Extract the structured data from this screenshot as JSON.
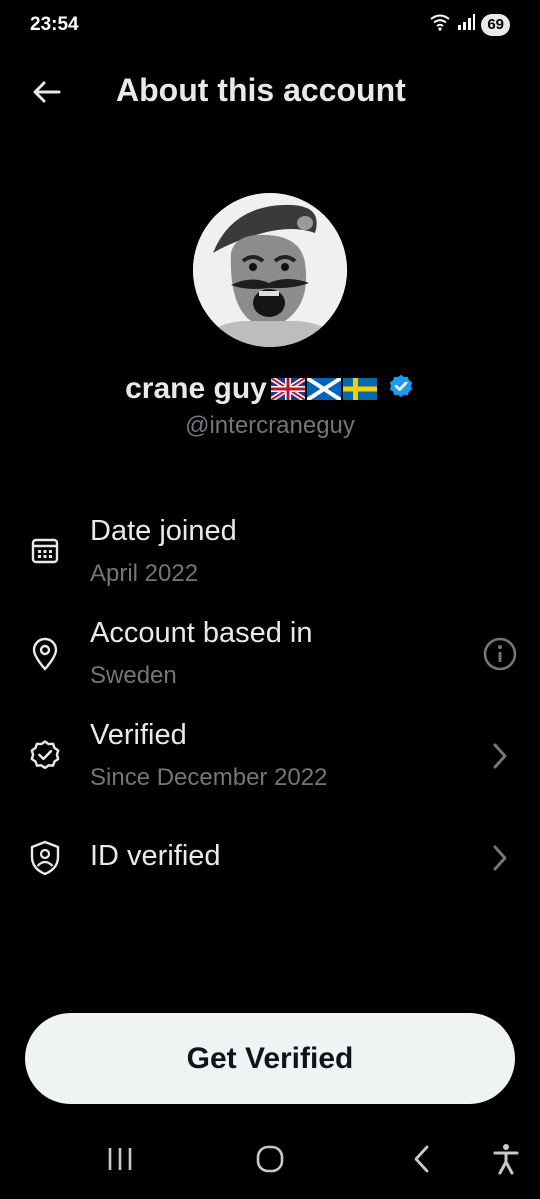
{
  "status_bar": {
    "time": "23:54",
    "battery": "69"
  },
  "header": {
    "title": "About this account"
  },
  "profile": {
    "display_name": "crane guy",
    "flags": [
      "uk-flag",
      "scotland-flag",
      "sweden-flag"
    ],
    "handle": "@intercraneguy",
    "verified_color": "#1d9bf0"
  },
  "rows": [
    {
      "icon": "calendar-icon",
      "title": "Date joined",
      "subtitle": "April 2022",
      "trailing": "none"
    },
    {
      "icon": "location-pin-icon",
      "title": "Account based in",
      "subtitle": "Sweden",
      "trailing": "info-icon"
    },
    {
      "icon": "verified-seal-icon",
      "title": "Verified",
      "subtitle": "Since December 2022",
      "trailing": "chevron-right-icon"
    },
    {
      "icon": "shield-user-icon",
      "title": "ID verified",
      "subtitle": "",
      "trailing": "chevron-right-icon"
    }
  ],
  "cta": {
    "label": "Get Verified"
  },
  "colors": {
    "background": "#000000",
    "text": "#e7e9ea",
    "muted": "#71767b",
    "button_bg": "#eff3f4"
  }
}
